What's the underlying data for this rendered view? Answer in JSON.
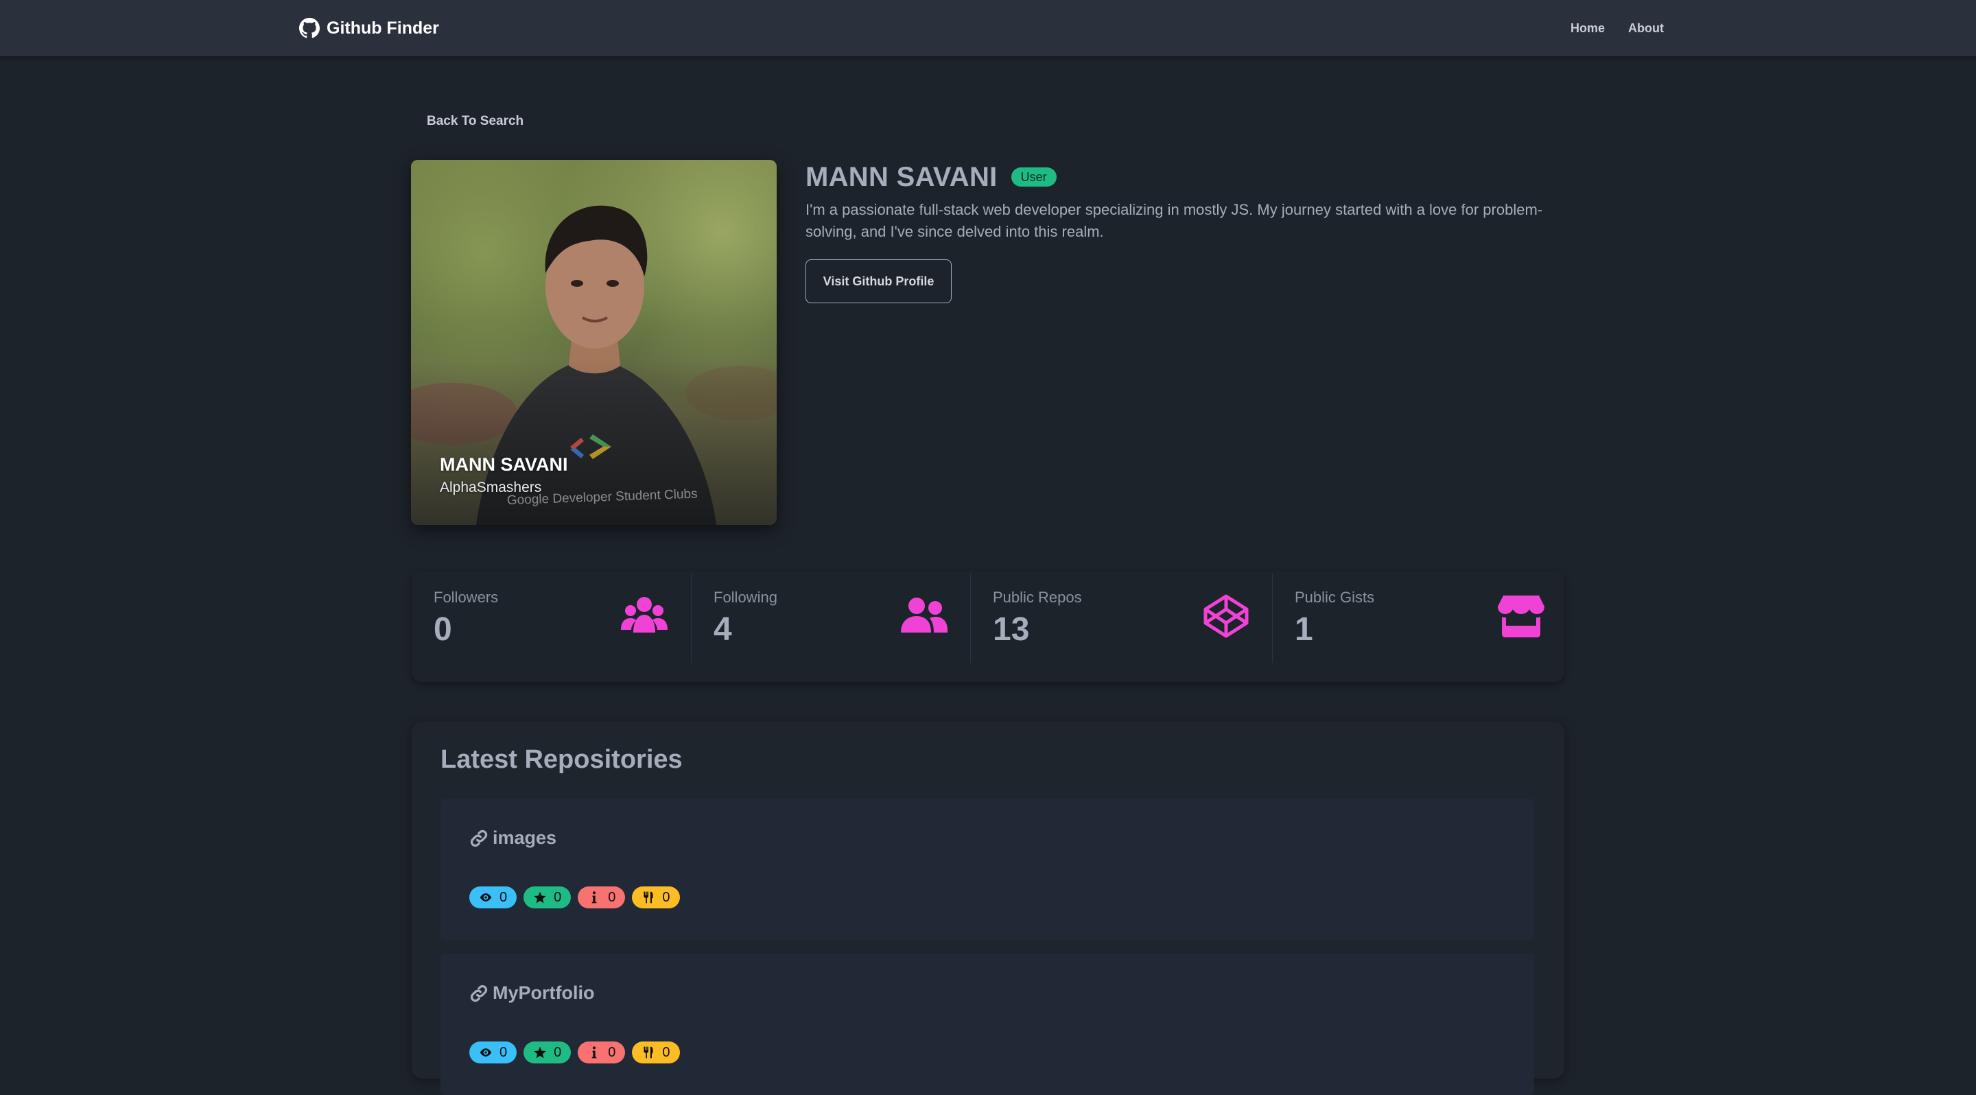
{
  "navbar": {
    "brand": "Github Finder",
    "links": [
      "Home",
      "About"
    ]
  },
  "back_link": "Back To Search",
  "profile": {
    "name": "MANN SAVANI",
    "type_badge": "User",
    "bio": "I'm a passionate full-stack web developer specializing in mostly JS. My journey started with a love for problem-solving, and I've since delved into this realm.",
    "visit_button": "Visit Github Profile",
    "avatar_caption": "MANN SAVANI",
    "avatar_login": "AlphaSmashers"
  },
  "stats": [
    {
      "title": "Followers",
      "value": "0",
      "icon": "users-icon"
    },
    {
      "title": "Following",
      "value": "4",
      "icon": "user-friends-icon"
    },
    {
      "title": "Public Repos",
      "value": "13",
      "icon": "codepen-icon"
    },
    {
      "title": "Public Gists",
      "value": "1",
      "icon": "store-icon"
    }
  ],
  "repos": {
    "title": "Latest Repositories",
    "items": [
      {
        "name": "images",
        "watchers": "0",
        "stars": "0",
        "issues": "0",
        "forks": "0"
      },
      {
        "name": "MyPortfolio",
        "watchers": "0",
        "stars": "0",
        "issues": "0",
        "forks": "0"
      }
    ]
  },
  "colors": {
    "accent_pink": "#f142d6",
    "success": "#1ebc84",
    "info": "#3abff8",
    "error": "#f87272",
    "warning": "#fbbd23",
    "background": "#1d232a",
    "navbar": "#2a303c"
  }
}
